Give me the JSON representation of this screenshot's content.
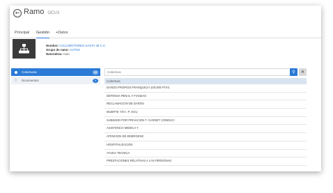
{
  "header": {
    "back_glyph": "←",
    "title": "Ramo",
    "subtitle": "OCU3"
  },
  "tabs": [
    {
      "label": "Principal",
      "active": false
    },
    {
      "label": "Gestión",
      "active": true
    },
    {
      "label": "+Datos",
      "active": false
    }
  ],
  "entity": {
    "icon": "org-chart-icon",
    "rows": [
      {
        "key": "Nombre:",
        "value": "CICLOMOTORES HASTA 49 C.C."
      },
      {
        "key": "Grupo de ramo:",
        "value": "AUTOS"
      },
      {
        "key": "Naturaleza:",
        "value": "Auto"
      }
    ]
  },
  "sidebar": {
    "items": [
      {
        "label": "Coberturas",
        "badge": "10",
        "active": true,
        "icon": "dot-icon"
      },
      {
        "label": "Documentos",
        "badge": "0",
        "active": false,
        "icon": "document-icon"
      }
    ]
  },
  "search": {
    "placeholder": "Cobertura",
    "search_icon": "search-icon",
    "clear_icon": "close-icon"
  },
  "list": {
    "header": "Cobertura",
    "rows": [
      "DAÑOS PROPIOS FRANQUICIA 100.000 PTAS.",
      "DEFENSA PENAL Y FIANZAS",
      "RECLAMACION DE DAÑOS",
      "MUERTE Y/O I. P. OCU",
      "SUBSIDIO POR PRIVACION T. CARNET CONDUCI",
      "ASISTENCIA MEDICA Y",
      "ATENCION DE EMERGENC",
      "HOSPITALIZACION",
      "AYUDA TECNICA",
      "PRESTACIONES RELATIVAS A LAS PERSONAS"
    ]
  },
  "colors": {
    "accent": "#2a7ad6",
    "entity_bg": "#3a3a3a",
    "list_header_bg": "#d9e4f0"
  }
}
